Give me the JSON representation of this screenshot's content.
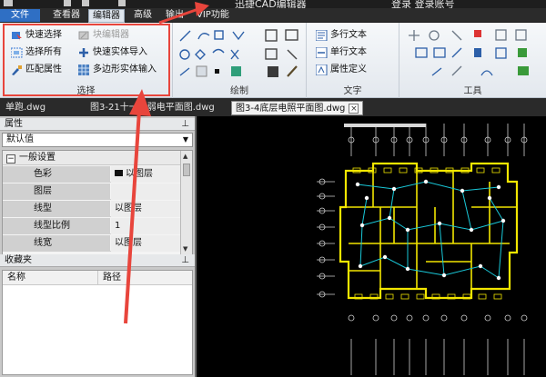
{
  "titlebar": {
    "title": "迅捷CAD编辑器",
    "right_text": "登录   登录账号"
  },
  "menu": {
    "items": [
      "文件",
      "查看器",
      "编辑器",
      "高级",
      "输出",
      "VIP功能"
    ]
  },
  "ribbon": {
    "groups": {
      "select": {
        "label": "选择",
        "buttons": [
          "快速选择",
          "选择所有",
          "匹配属性",
          "块编辑器",
          "快速实体导入",
          "多边形实体输入"
        ]
      },
      "draw": {
        "label": "绘制"
      },
      "text": {
        "label": "文字",
        "buttons": [
          "多行文本",
          "单行文本",
          "属性定义"
        ]
      },
      "tools": {
        "label": "工具"
      }
    }
  },
  "tabs": [
    "单跑.dwg",
    "图3-21十一层弱电平面图.dwg",
    "图3-4底层电照平面图.dwg"
  ],
  "properties": {
    "header": "属性",
    "dropdown_value": "默认值",
    "section": "一般设置",
    "rows": [
      {
        "name": "色彩",
        "value": "以图层"
      },
      {
        "name": "图层",
        "value": ""
      },
      {
        "name": "线型",
        "value": "以图层"
      },
      {
        "name": "线型比例",
        "value": "1"
      },
      {
        "name": "线宽",
        "value": "以图层"
      }
    ]
  },
  "favorites": {
    "header": "收藏夹",
    "columns": [
      "名称",
      "路径"
    ]
  },
  "colors": {
    "accent": "#2f6fc4",
    "highlight": "#e8453c",
    "drawing": "#f2e600",
    "wire": "#19c8d8"
  }
}
